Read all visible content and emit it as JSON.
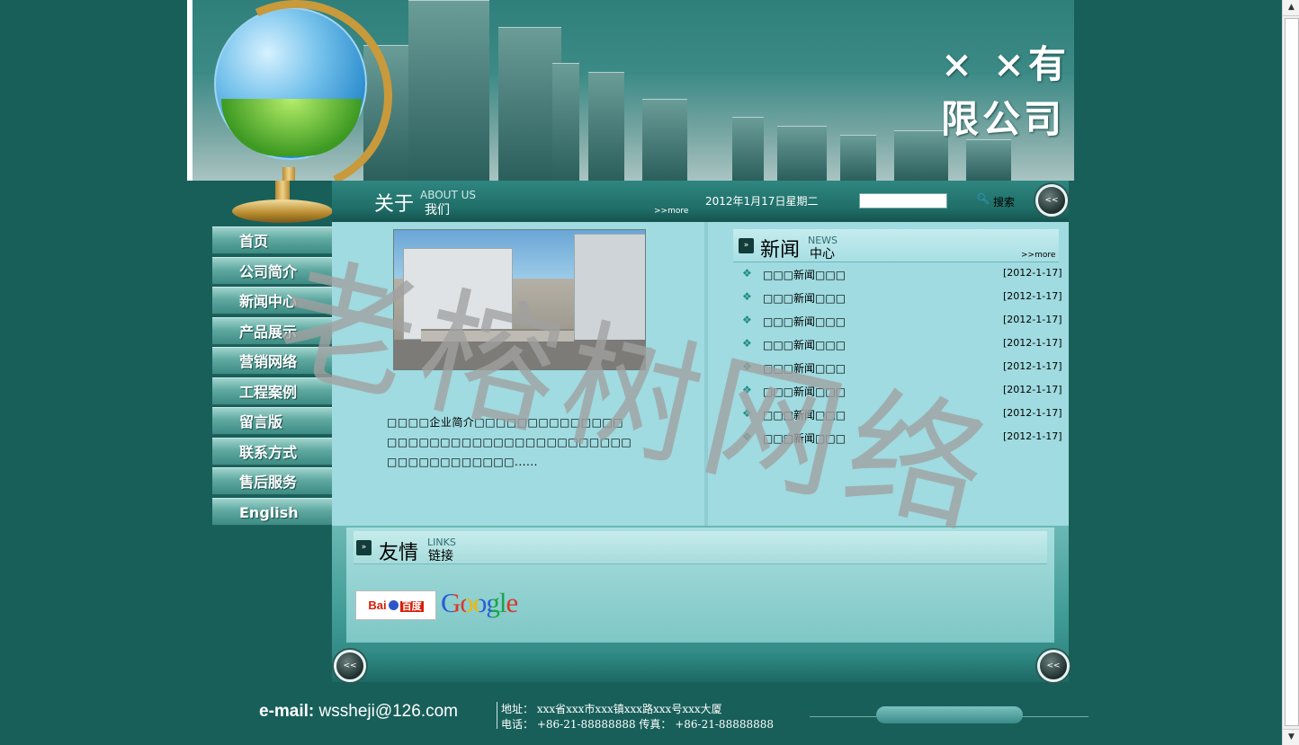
{
  "header": {
    "company_name": "× ×有限公司"
  },
  "nav": {
    "items": [
      {
        "label": "首页"
      },
      {
        "label": "公司简介"
      },
      {
        "label": "新闻中心"
      },
      {
        "label": "产品展示"
      },
      {
        "label": "营销网络"
      },
      {
        "label": "工程案例"
      },
      {
        "label": "留言版"
      },
      {
        "label": "联系方式"
      },
      {
        "label": "售后服务"
      },
      {
        "label": "English"
      }
    ]
  },
  "topbar": {
    "about_cn": "关于",
    "about_en": "ABOUT US",
    "about_cn2": "我们",
    "about_more": ">>more",
    "date": "2012年1月17日星期二",
    "search_value": "",
    "search_label": "搜索",
    "search_icon": "search-icon",
    "nav_button": "<<"
  },
  "about": {
    "text": "□□□□企业简介□□□□□□□□□□□□□□ □□□□□□□□□□□□□□□□□□□□□□□ □□□□□□□□□□□□......"
  },
  "news": {
    "title_cn": "新闻",
    "title_en": "NEWS",
    "title_cn2": "中心",
    "more": ">>more",
    "items": [
      {
        "title": "□□□新闻□□□",
        "date": "[2012-1-17]"
      },
      {
        "title": "□□□新闻□□□",
        "date": "[2012-1-17]"
      },
      {
        "title": "□□□新闻□□□",
        "date": "[2012-1-17]"
      },
      {
        "title": "□□□新闻□□□",
        "date": "[2012-1-17]"
      },
      {
        "title": "□□□新闻□□□",
        "date": "[2012-1-17]"
      },
      {
        "title": "□□□新闻□□□",
        "date": "[2012-1-17]"
      },
      {
        "title": "□□□新闻□□□",
        "date": "[2012-1-17]"
      },
      {
        "title": "□□□新闻□□□",
        "date": "[2012-1-17]"
      }
    ]
  },
  "links": {
    "title_cn": "友情",
    "title_en": "LINKS",
    "title_cn2": "链接",
    "baidu_text": "Bai",
    "baidu_cn": "百度",
    "google_text": "Google"
  },
  "footer": {
    "email_label": "e-mail:",
    "email": "wssheji@126.com",
    "address": "地址： xxx省xxx市xxx镇xxx路xxx号xxx大厦",
    "tel": "电话： +86-21-88888888  传真： +86-21-88888888"
  },
  "watermark": "老榕树网络",
  "colors": {
    "page_bg": "#185f5a",
    "panel_bg": "#9fdbe0",
    "accent_teal": "#1f6d67"
  }
}
